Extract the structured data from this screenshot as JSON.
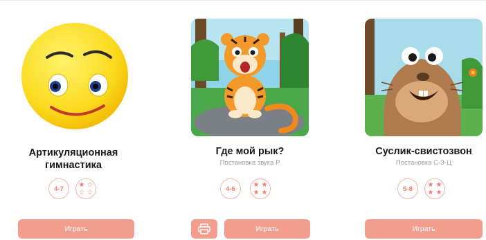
{
  "cards": [
    {
      "title_line1": "Артикуляционная",
      "title_line2": "гимнастика",
      "age": "4-7",
      "play_label": "Играть",
      "image_icon": "smiley-face-icon",
      "difficulty_stars": 1
    },
    {
      "title": "Где мой рык?",
      "subtitle": "Постановка звука Р",
      "age": "4-6",
      "play_label": "Играть",
      "image_icon": "tiger-illustration-icon",
      "difficulty_stars": 4
    },
    {
      "title": "Суслик-свистозвон",
      "subtitle": "Постановка С-З-Ц",
      "age": "5-8",
      "play_label": "Играть",
      "image_icon": "gopher-illustration-icon",
      "difficulty_stars": 4
    }
  ],
  "colors": {
    "accent": "#f39d8f",
    "accent_text": "#ee7d6e",
    "border": "#f2b4aa"
  },
  "icons": {
    "star_full": "★",
    "star_empty": "☆",
    "print": "printer-icon"
  }
}
